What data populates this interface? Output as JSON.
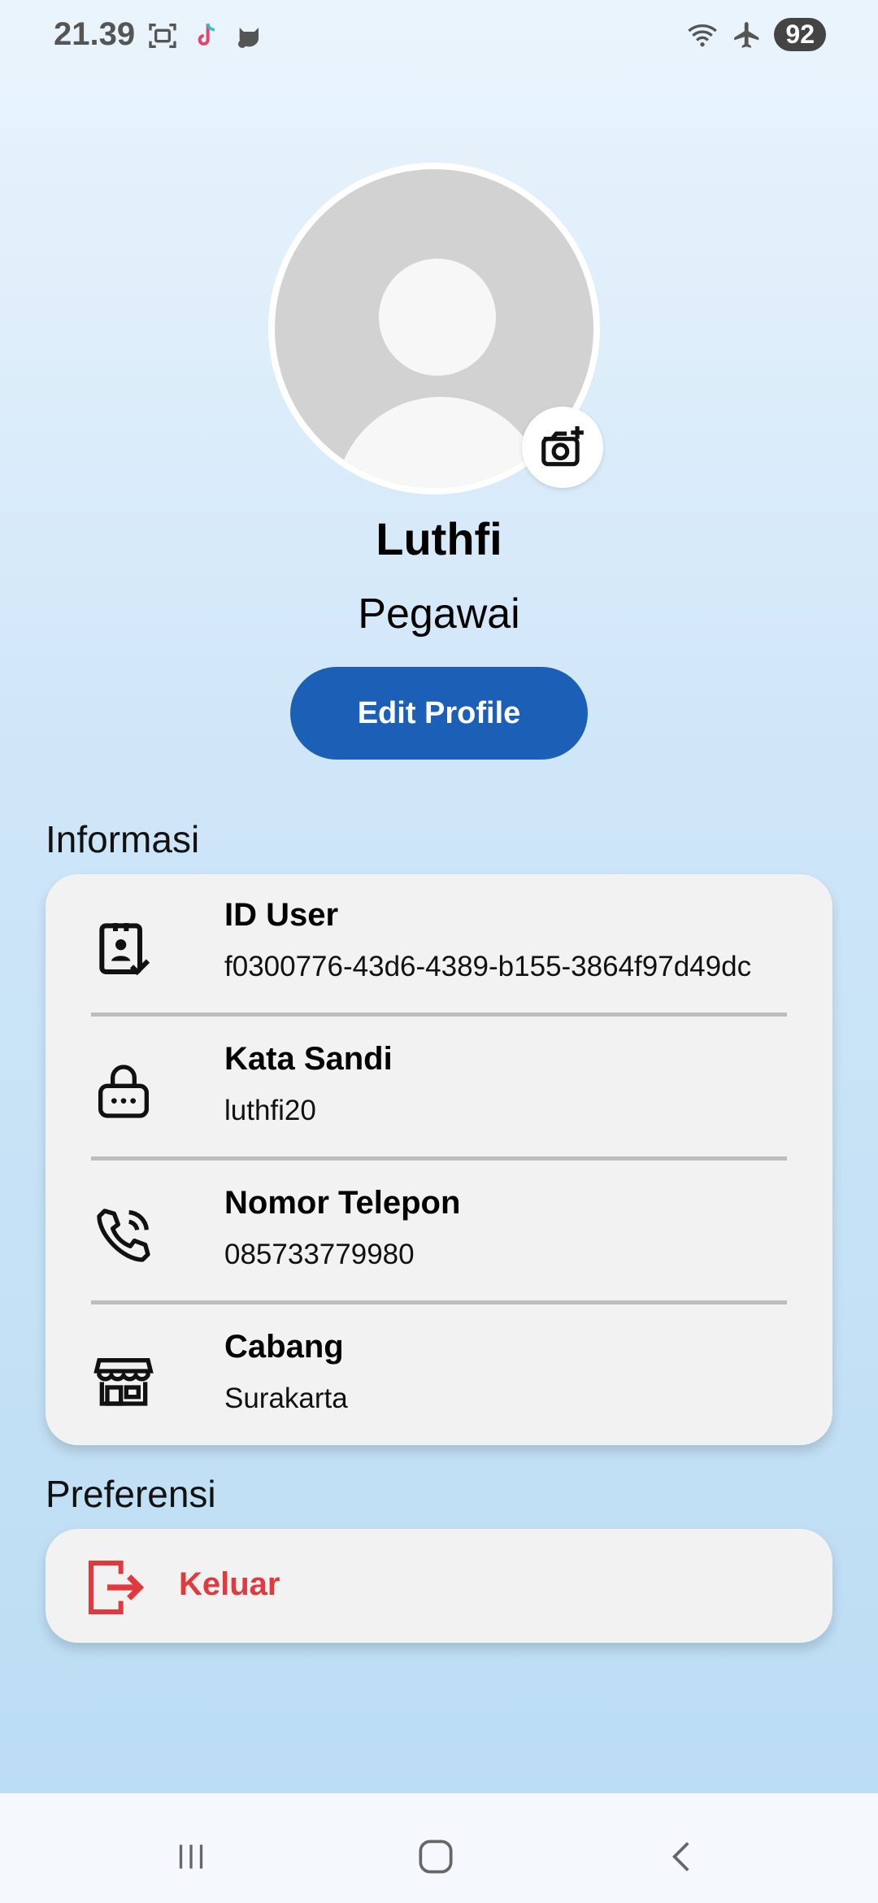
{
  "status_bar": {
    "time": "21.39",
    "battery": "92",
    "icons": [
      "screenshot-icon",
      "tiktok-icon",
      "cat-icon",
      "wifi-icon",
      "airplane-mode-icon",
      "battery-icon"
    ]
  },
  "profile": {
    "name": "Luthfi",
    "role": "Pegawai",
    "edit_button": "Edit Profile"
  },
  "info_section": {
    "title": "Informasi",
    "items": [
      {
        "label": "ID User",
        "value": "f0300776-43d6-4389-b155-3864f97d49dc",
        "icon": "id-badge-icon"
      },
      {
        "label": "Kata Sandi",
        "value": "luthfi20",
        "icon": "lock-icon"
      },
      {
        "label": "Nomor Telepon",
        "value": "085733779980",
        "icon": "phone-icon"
      },
      {
        "label": "Cabang",
        "value": "Surakarta",
        "icon": "store-icon"
      }
    ]
  },
  "preferences_section": {
    "title": "Preferensi",
    "logout_label": "Keluar"
  },
  "colors": {
    "accent": "#1b5fb7",
    "logout": "#e0393e",
    "card": "#f2f2f2"
  },
  "nav_bar": {
    "buttons": [
      "recent-apps-icon",
      "home-icon",
      "back-icon"
    ]
  }
}
